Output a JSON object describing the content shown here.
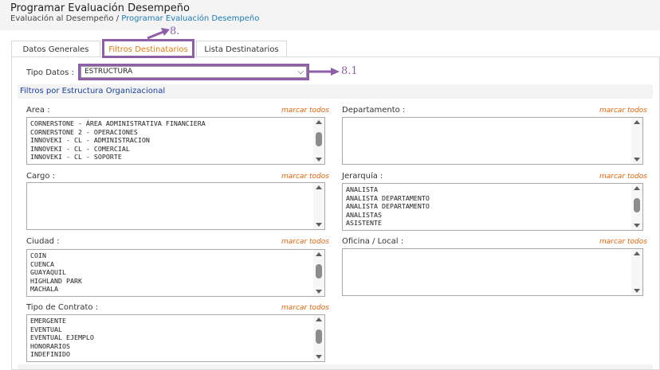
{
  "header": {
    "title": "Programar Evaluación Desempeño",
    "breadcrumb_root": "Evaluación al Desempeño",
    "breadcrumb_sep": "/",
    "breadcrumb_current": "Programar Evaluación Desempeño"
  },
  "tabs": [
    {
      "label": "Datos Generales",
      "active": false
    },
    {
      "label": "Filtros Destinatarios",
      "active": true
    },
    {
      "label": "Lista Destinatarios",
      "active": false
    }
  ],
  "tipo_datos": {
    "label": "Tipo Datos :",
    "selected": "ESTRUCTURA"
  },
  "section": {
    "title": "Filtros por Estructura Organizacional"
  },
  "marcar_todos": "marcar todos",
  "filters": {
    "area": {
      "label": "Area :",
      "items": [
        "CORNERSTONE - ÁREA ADMINISTRATIVA FINANCIERA",
        "CORNERSTONE 2 - OPERACIONES",
        "INNOVEKI - CL - ADMINISTRACION",
        "INNOVEKI - CL - COMERCIAL",
        "INNOVEKI - CL - SOPORTE"
      ]
    },
    "departamento": {
      "label": "Departamento :",
      "items": []
    },
    "cargo": {
      "label": "Cargo :",
      "items": []
    },
    "jerarquia": {
      "label": "Jerarquía :",
      "items": [
        "ANALISTA",
        "ANALISTA DEPARTAMENTO",
        "ANALISTA DEPARTAMENTO",
        "ANALISTAS",
        "ASISTENTE"
      ]
    },
    "ciudad": {
      "label": "Ciudad :",
      "items": [
        "COIN",
        "CUENCA",
        "GUAYAQUIL",
        "HIGHLAND PARK",
        "MACHALA"
      ]
    },
    "oficina": {
      "label": "Oficina / Local :",
      "items": []
    },
    "tipo_contrato": {
      "label": "Tipo de Contrato :",
      "items": [
        "EMERGENTE",
        "EVENTUAL",
        "EVENTUAL EJEMPLO",
        "HONORARIOS",
        "INDEFINIDO"
      ]
    }
  },
  "annotations": {
    "tab_marker": "8.",
    "select_marker": "8.1",
    "color": "#8e5ea8"
  }
}
